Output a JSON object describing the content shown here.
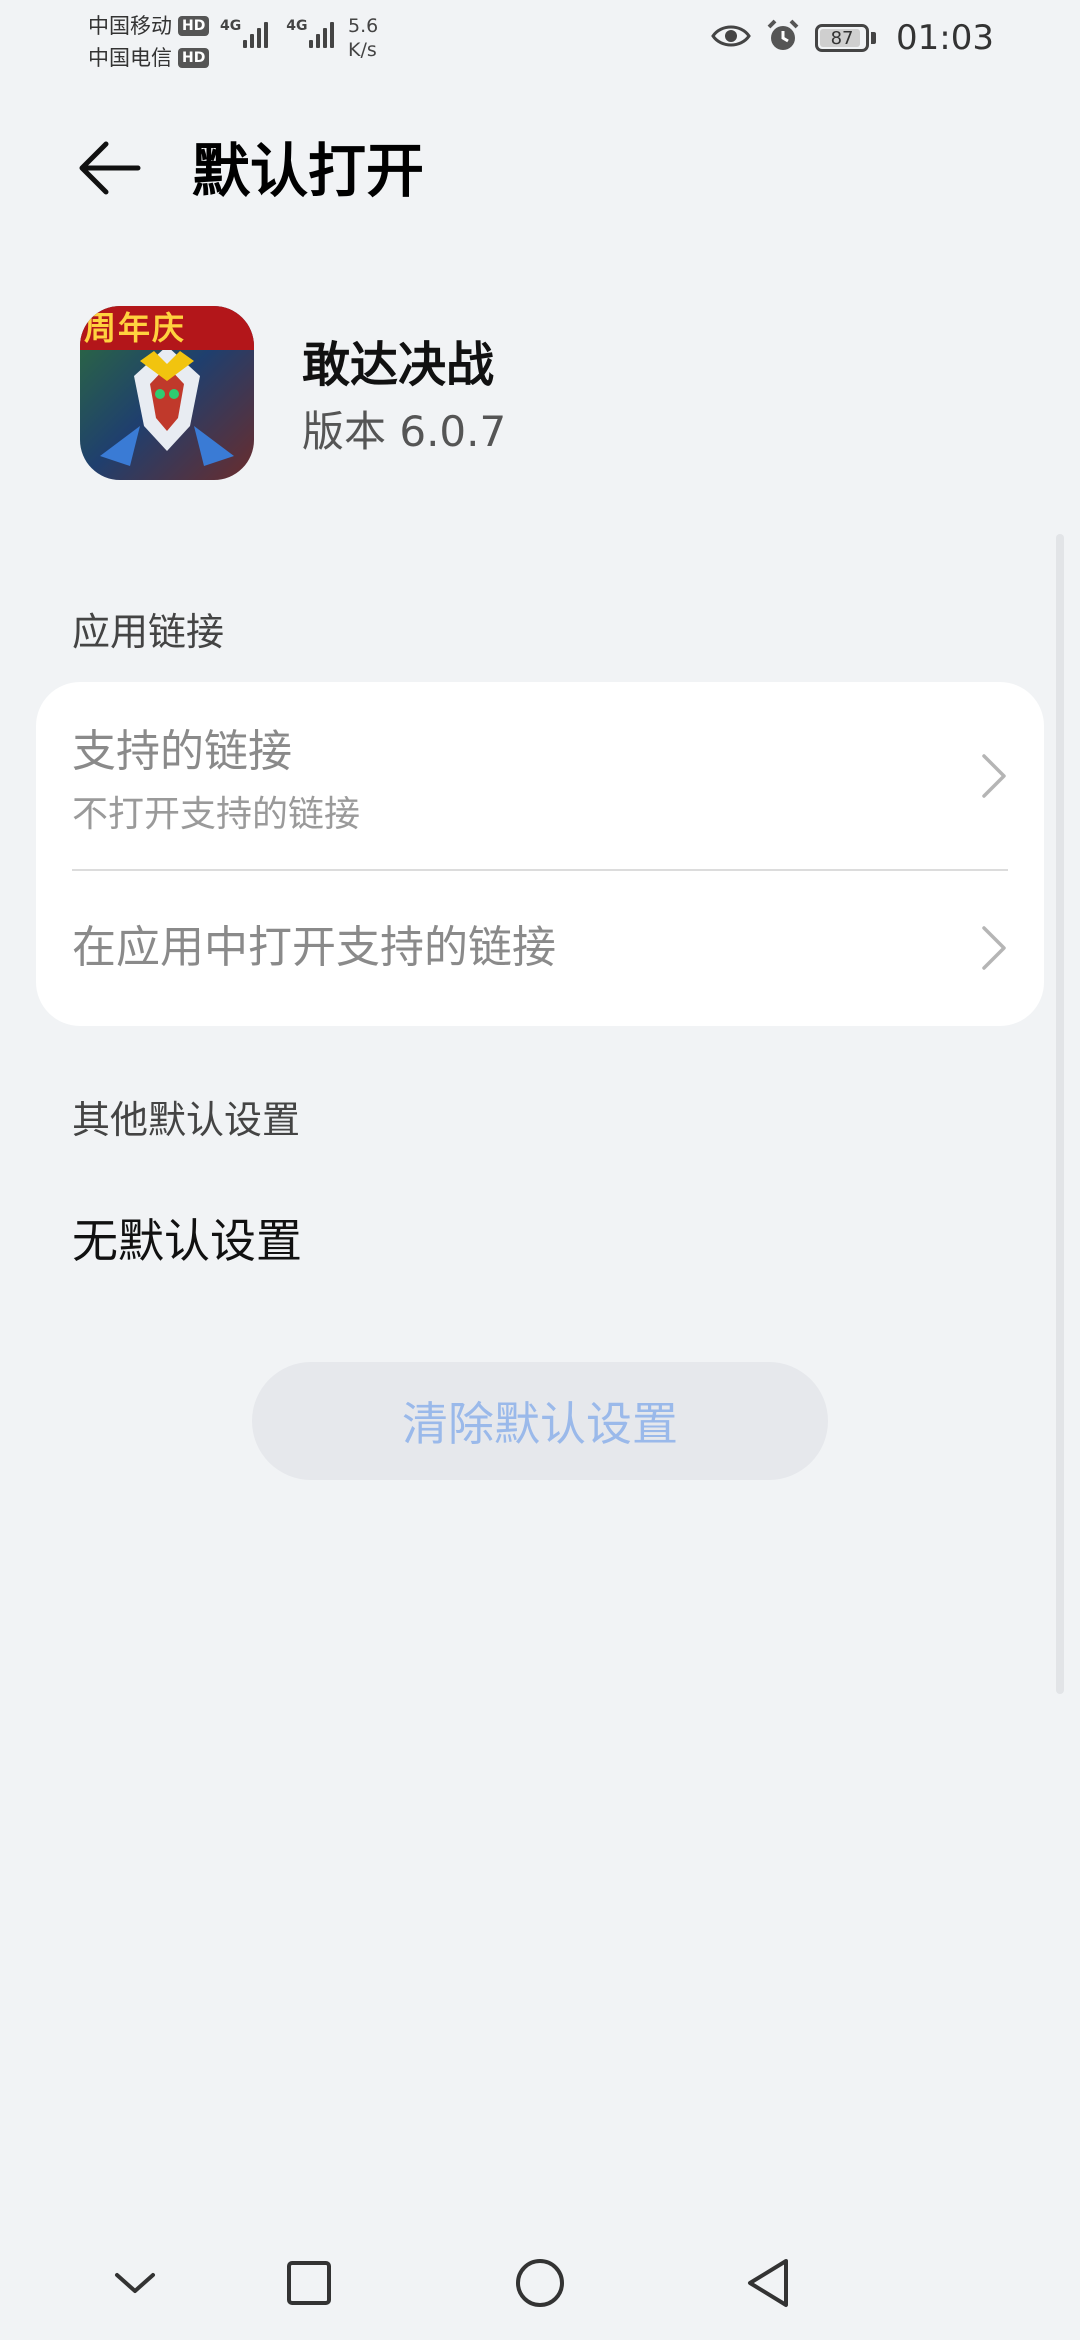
{
  "status_bar": {
    "carrier_1": "中国移动",
    "carrier_2": "中国电信",
    "hd_badge": "HD",
    "network_type": "4G",
    "speed_value": "5.6",
    "speed_unit": "K/s",
    "battery": "87",
    "time": "01:03",
    "icons": [
      "eye-icon",
      "alarm-icon",
      "battery-icon"
    ]
  },
  "header": {
    "title": "默认打开",
    "back_icon": "arrow-left-icon"
  },
  "app": {
    "name": "敢达决战",
    "version": "版本 6.0.7",
    "icon_badge_text": "周年庆"
  },
  "sections": {
    "app_links_title": "应用链接",
    "other_defaults_title": "其他默认设置"
  },
  "app_links": {
    "supported_links": {
      "title": "支持的链接",
      "subtitle": "不打开支持的链接"
    },
    "open_in_app": {
      "title": "在应用中打开支持的链接"
    }
  },
  "other_defaults": {
    "value": "无默认设置"
  },
  "clear_button": {
    "label": "清除默认设置"
  },
  "nav_bar": {
    "icons": [
      "chevron-down-icon",
      "square-icon",
      "circle-home-icon",
      "triangle-back-icon"
    ]
  },
  "colors": {
    "background": "#f1f3f5",
    "card": "#ffffff",
    "disabled_text": "#8a8a8a",
    "button_text": "#9ab9ea",
    "button_bg": "#e6e8ec"
  }
}
